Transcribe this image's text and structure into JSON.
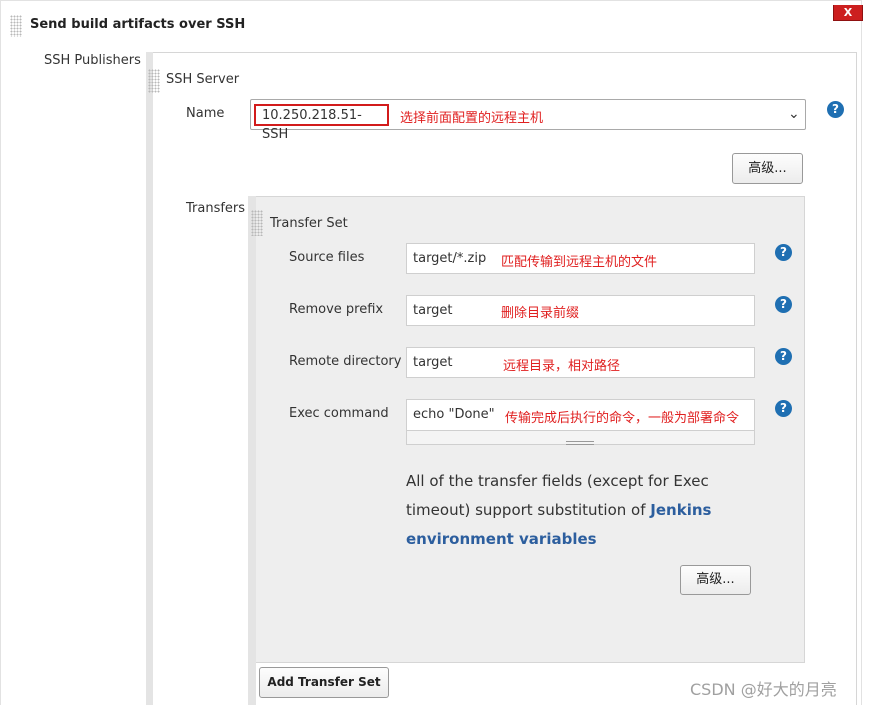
{
  "section": {
    "title": "Send build artifacts over SSH",
    "delete_label": "X"
  },
  "publishers": {
    "label": "SSH Publishers"
  },
  "ssh_server": {
    "header": "SSH Server",
    "name_label": "Name",
    "name_value": "10.250.218.51-SSH",
    "name_annotation": "选择前面配置的远程主机",
    "help_glyph": "?",
    "advanced_label": "高级..."
  },
  "transfers": {
    "label": "Transfers",
    "set_header": "Transfer Set",
    "fields": [
      {
        "label": "Source files",
        "value": "target/*.zip",
        "annotation": "匹配传输到远程主机的文件"
      },
      {
        "label": "Remove prefix",
        "value": "target",
        "annotation": "删除目录前缀"
      },
      {
        "label": "Remote directory",
        "value": "target",
        "annotation": "远程目录，相对路径"
      },
      {
        "label": "Exec command",
        "value": "echo \"Done\"",
        "annotation": "传输完成后执行的命令，一般为部署命令"
      }
    ],
    "info_text": "All of the transfer fields (except for Exec timeout) support substitution of",
    "info_link": "Jenkins environment variables",
    "advanced_label": "高级...",
    "add_button": "Add Transfer Set"
  },
  "watermark": "CSDN @好大的月亮",
  "colors": {
    "help_blue": "#1f6fb2",
    "annotation_red": "#e02020",
    "delete_red": "#cc1f1f",
    "link_blue": "#2c5e9e"
  }
}
